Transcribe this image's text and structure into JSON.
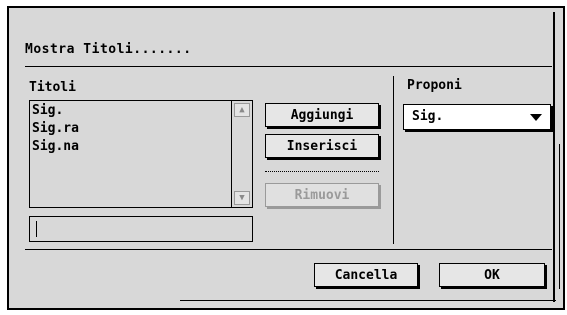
{
  "dialog": {
    "title": "Mostra Titoli......."
  },
  "titles_section": {
    "label": "Titoli",
    "items": [
      "Sig.",
      "Sig.ra",
      "Sig.na"
    ],
    "input_value": ""
  },
  "buttons": {
    "add_label": "Aggiungi",
    "insert_label": "Inserisci",
    "remove_label": "Rimuovi",
    "cancel_label": "Cancella",
    "ok_label": "OK"
  },
  "propose_section": {
    "label": "Proponi",
    "selected": "Sig."
  },
  "icons": {
    "scroll_up": "scroll-up-arrow-icon",
    "scroll_down": "scroll-down-arrow-icon",
    "dropdown": "chevron-down-icon"
  }
}
